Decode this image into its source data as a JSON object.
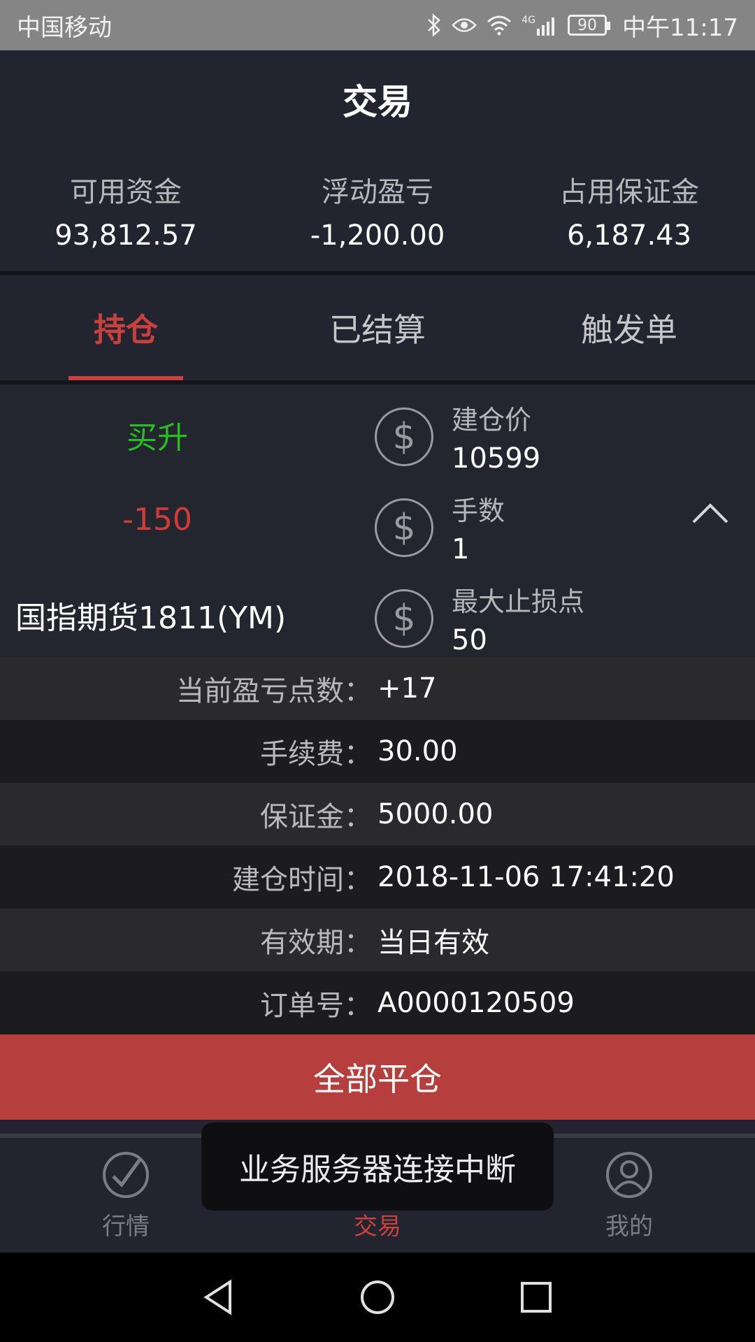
{
  "status_bar": {
    "carrier": "中国移动",
    "signal_label": "4G",
    "battery": "90",
    "time": "中午11:17"
  },
  "header": {
    "title": "交易"
  },
  "summary": [
    {
      "label": "可用资金",
      "value": "93,812.57"
    },
    {
      "label": "浮动盈亏",
      "value": "-1,200.00"
    },
    {
      "label": "占用保证金",
      "value": "6,187.43"
    }
  ],
  "tabs": [
    {
      "label": "持仓",
      "active": true
    },
    {
      "label": "已结算",
      "active": false
    },
    {
      "label": "触发单",
      "active": false
    }
  ],
  "position": {
    "direction": "买升",
    "pnl_points": "-150",
    "product": "国指期货1811(YM)",
    "info": [
      {
        "label": "建仓价",
        "value": "10599",
        "icon": "dollar-icon"
      },
      {
        "label": "手数",
        "value": "1",
        "icon": "dollar-icon"
      },
      {
        "label": "最大止损点",
        "value": "50",
        "icon": "dollar-icon"
      }
    ]
  },
  "details": [
    {
      "label": "当前盈亏点数：",
      "value": "+17"
    },
    {
      "label": "手续费：",
      "value": "30.00"
    },
    {
      "label": "保证金：",
      "value": "5000.00"
    },
    {
      "label": "建仓时间：",
      "value": "2018-11-06 17:41:20"
    },
    {
      "label": "有效期：",
      "value": "当日有效"
    },
    {
      "label": "订单号：",
      "value": "A0000120509"
    }
  ],
  "close_all_label": "全部平仓",
  "bottom_nav": [
    {
      "label": "行情",
      "icon": "market-check-icon",
      "active": false
    },
    {
      "label": "交易",
      "icon": "trade-icon",
      "active": true
    },
    {
      "label": "我的",
      "icon": "user-icon",
      "active": false
    }
  ],
  "toast": "业务服务器连接中断",
  "colors": {
    "accent_red": "#c9413d",
    "buy_green": "#24c01e",
    "background": "#22242f",
    "close_button": "#b63e3c"
  }
}
